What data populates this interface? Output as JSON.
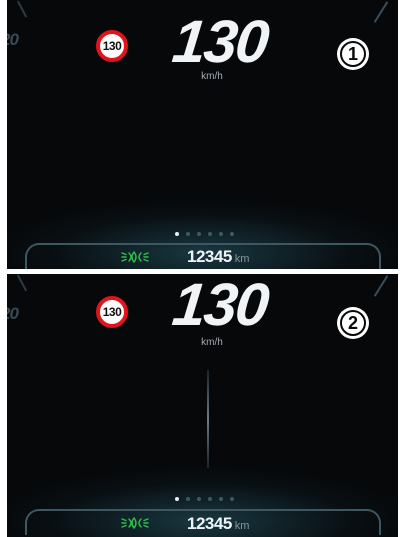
{
  "panels": [
    {
      "speed_limit": "130",
      "speed": "130",
      "speed_unit": "km/h",
      "index": "1",
      "odometer": "12345",
      "odometer_unit": "km",
      "page_dots": 6,
      "active_dot": 0,
      "partial_speed_text": "20",
      "has_needle": false
    },
    {
      "speed_limit": "130",
      "speed": "130",
      "speed_unit": "km/h",
      "index": "2",
      "odometer": "12345",
      "odometer_unit": "km",
      "page_dots": 6,
      "active_dot": 0,
      "partial_speed_text": "20",
      "has_needle": true
    }
  ],
  "icons": {
    "speed_limit": "speed-limit-sign-icon",
    "lights": "parking-lights-icon"
  },
  "colors": {
    "background": "#06080a",
    "speed_limit_ring": "#e1131b",
    "lights_icon": "#2ec24a",
    "accent_glow": "#285f6e"
  }
}
